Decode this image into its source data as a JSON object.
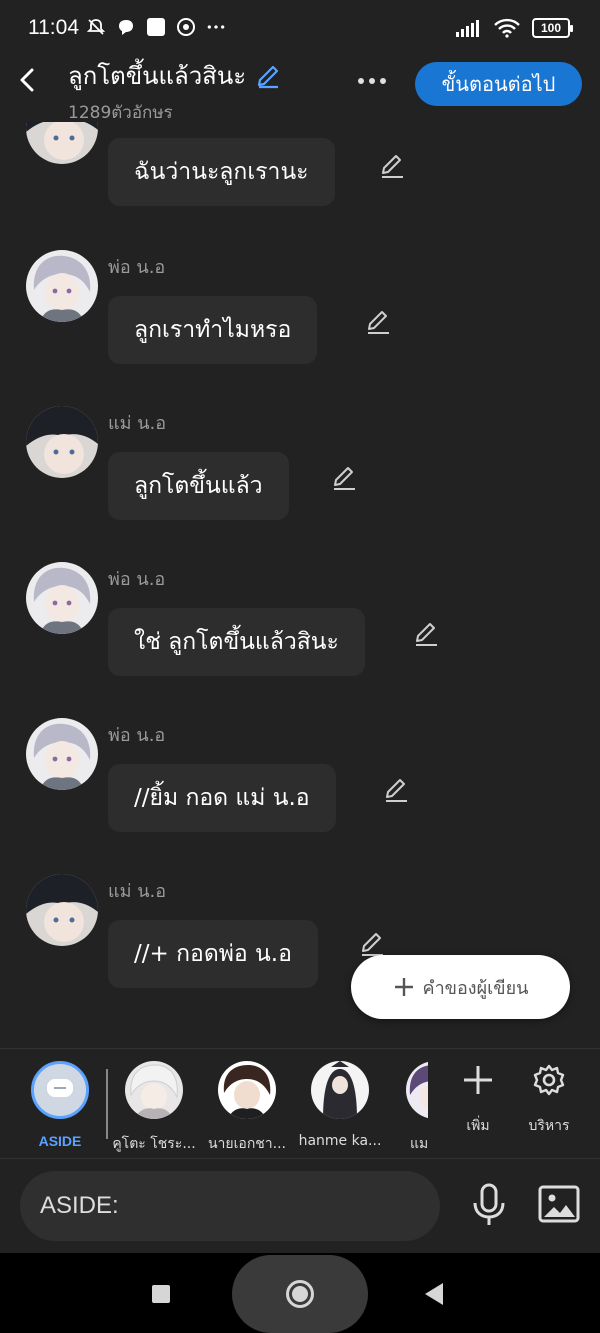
{
  "status": {
    "time": "11:04",
    "battery": "100",
    "icons_left": [
      "mute-icon",
      "chat-bubble-icon",
      "square-app-icon",
      "chrome-icon",
      "more-dots-icon"
    ],
    "icons_right": [
      "signal-icon",
      "wifi-icon",
      "battery-icon"
    ]
  },
  "header": {
    "title": "ลูกโตขึ้นแล้วสินะ",
    "char_count": "1289ตัวอักษร",
    "next_label": "ขั้นตอนต่อไป",
    "accent": "#1976d2"
  },
  "messages": [
    {
      "sender": "",
      "text": "ฉันว่านะลูกเรานะ",
      "avatar": "dark-hair"
    },
    {
      "sender": "พ่อ น.อ",
      "text": "ลูกเราทำไมหรอ",
      "avatar": "silver-hair"
    },
    {
      "sender": "แม่ น.อ",
      "text": "ลูกโตขึ้นแล้ว",
      "avatar": "dark-hair"
    },
    {
      "sender": "พ่อ น.อ",
      "text": "ใช่ ลูกโตขึ้นแล้วสินะ",
      "avatar": "silver-hair"
    },
    {
      "sender": "พ่อ น.อ",
      "text": "//ยิ้ม กอด แม่ น.อ",
      "avatar": "silver-hair"
    },
    {
      "sender": "แม่ น.อ",
      "text": "//+ กอดพ่อ น.อ",
      "avatar": "dark-hair"
    }
  ],
  "author_button": "คำของผู้เขียน",
  "characters": {
    "aside": "ASIDE",
    "list": [
      {
        "name": "คูโตะ โชระ...",
        "avatar": "white-hair"
      },
      {
        "name": "นายเอกชา...",
        "avatar": "brown-hair"
      },
      {
        "name": "hanme ka...",
        "avatar": "dark-robe"
      },
      {
        "name": "แม",
        "avatar": "purple-hair"
      }
    ],
    "add_label": "เพิ่ม",
    "manage_label": "บริหาร"
  },
  "input": {
    "value": "ASIDE:"
  }
}
